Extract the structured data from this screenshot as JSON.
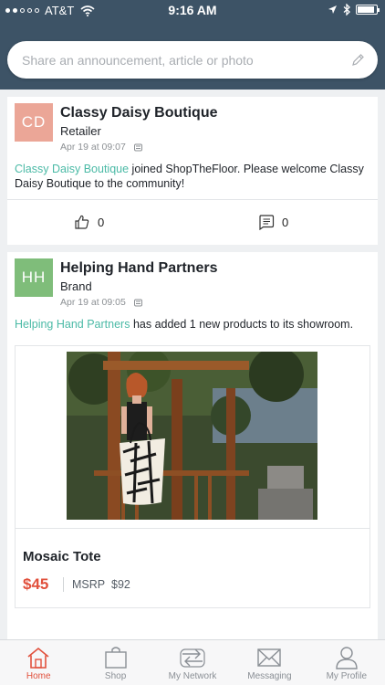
{
  "status_bar": {
    "carrier": "AT&T",
    "time": "9:16 AM",
    "signal_bars_filled": 2,
    "signal_bars_total": 5,
    "battery_level": 0.9
  },
  "composer": {
    "placeholder": "Share an announcement, article or photo",
    "icon": "pencil-icon"
  },
  "feed": [
    {
      "avatar_initials": "CD",
      "avatar_color": "#eba697",
      "name": "Classy Daisy Boutique",
      "type": "Retailer",
      "timestamp": "Apr 19 at 09:07",
      "text_link": "Classy Daisy Boutique",
      "text_rest": " joined ShopTheFloor. Please welcome Classy Daisy Boutique  to the community!",
      "likes": "0",
      "comments": "0"
    },
    {
      "avatar_initials": "HH",
      "avatar_color": "#7fbd7a",
      "name": "Helping Hand Partners",
      "type": "Brand",
      "timestamp": "Apr 19 at 09:05",
      "text_link": "Helping Hand Partners",
      "text_rest": " has added 1 new products to its showroom.",
      "product": {
        "name": "Mosaic Tote",
        "price": "$45",
        "msrp_label": "MSRP",
        "msrp": "$92"
      }
    }
  ],
  "tabs": [
    {
      "label": "Home",
      "icon": "home-icon",
      "active": true
    },
    {
      "label": "Shop",
      "icon": "shopping-bag-icon",
      "active": false
    },
    {
      "label": "My Network",
      "icon": "network-icon",
      "active": false
    },
    {
      "label": "Messaging",
      "icon": "envelope-icon",
      "active": false
    },
    {
      "label": "My Profile",
      "icon": "profile-icon",
      "active": false
    }
  ],
  "colors": {
    "header": "#3d5366",
    "accent": "#e1503c",
    "link": "#4bbaa6"
  }
}
